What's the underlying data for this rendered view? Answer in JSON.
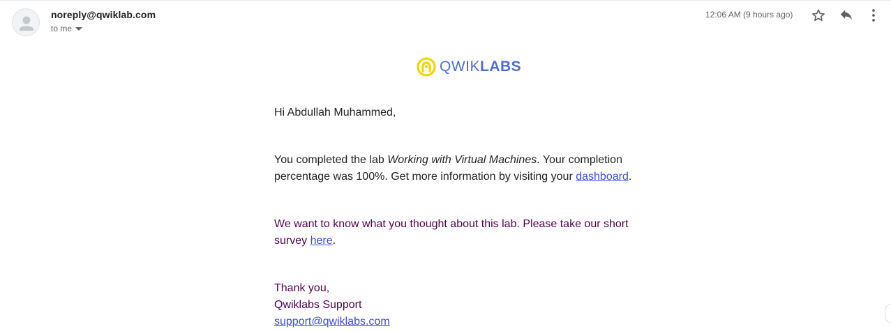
{
  "header": {
    "sender": "noreply@qwiklab.com",
    "recipient_label": "to me",
    "timestamp": "12:06 AM (9 hours ago)"
  },
  "icons": {
    "avatar": "person-avatar-icon",
    "star": "star-icon",
    "reply": "reply-icon",
    "more": "more-vert-icon",
    "dropdown": "caret-down-icon"
  },
  "logo": {
    "prefix": "QWIK",
    "suffix": "LABS",
    "accent_color": "#f4d600",
    "brand_color": "#4f6bdb"
  },
  "message": {
    "greeting": "Hi Abdullah Muhammed,",
    "p1_before": "You completed the lab ",
    "lab_name": "Working with Virtual Machines",
    "p1_middle": ". Your completion percentage was 100%. Get more information by visiting your ",
    "dashboard_link": "dashboard",
    "p1_end": ".",
    "p2_before": "We want to know what you thought about this lab. Please take our short survey ",
    "survey_link": "here",
    "p2_end": ".",
    "thanks": "Thank you,",
    "team": "Qwiklabs Support",
    "support_email": "support@qwiklabs.com"
  },
  "colors": {
    "link": "#3c4ce0",
    "quoted_text": "#500050",
    "muted": "#5f6368"
  }
}
